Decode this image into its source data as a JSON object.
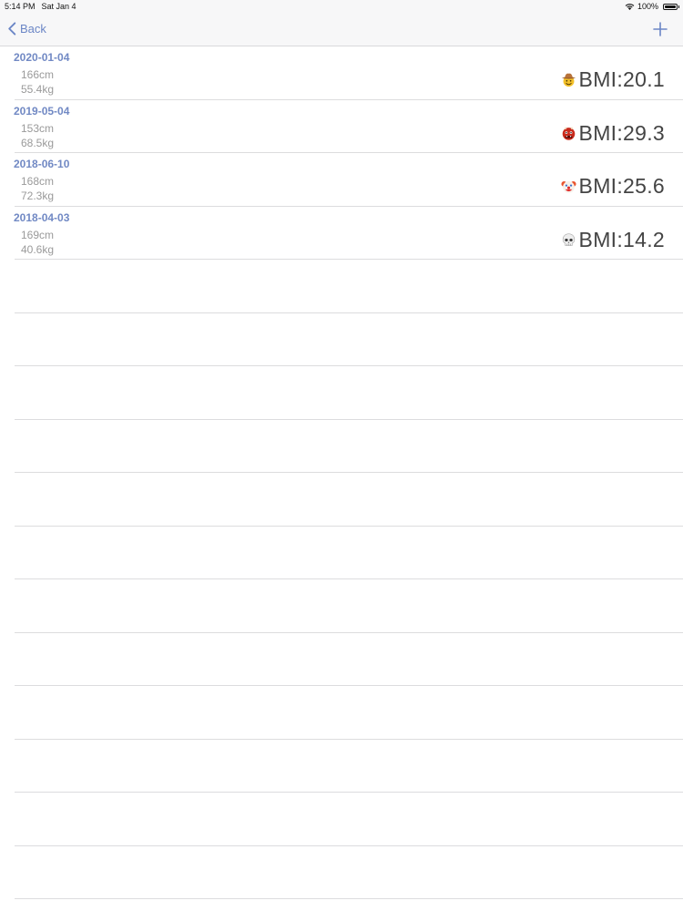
{
  "status_bar": {
    "time": "5:14 PM",
    "date": "Sat Jan 4",
    "battery": "100%"
  },
  "nav": {
    "back_label": "Back",
    "add_icon": "plus-icon"
  },
  "records": [
    {
      "date": "2020-01-04",
      "height": "166cm",
      "weight": "55.4kg",
      "bmi": "BMI:20.1",
      "emoji": "cowboy-face-icon"
    },
    {
      "date": "2019-05-04",
      "height": "153cm",
      "weight": "68.5kg",
      "bmi": "BMI:29.3",
      "emoji": "ogre-face-icon"
    },
    {
      "date": "2018-06-10",
      "height": "168cm",
      "weight": "72.3kg",
      "bmi": "BMI:25.6",
      "emoji": "clown-face-icon"
    },
    {
      "date": "2018-04-03",
      "height": "169cm",
      "weight": "40.6kg",
      "bmi": "BMI:14.2",
      "emoji": "skull-icon"
    }
  ],
  "colors": {
    "accent": "#6b86c6",
    "date_text": "#7189c4",
    "secondary_text": "#9a9a9a",
    "bmi_text": "#444444"
  }
}
